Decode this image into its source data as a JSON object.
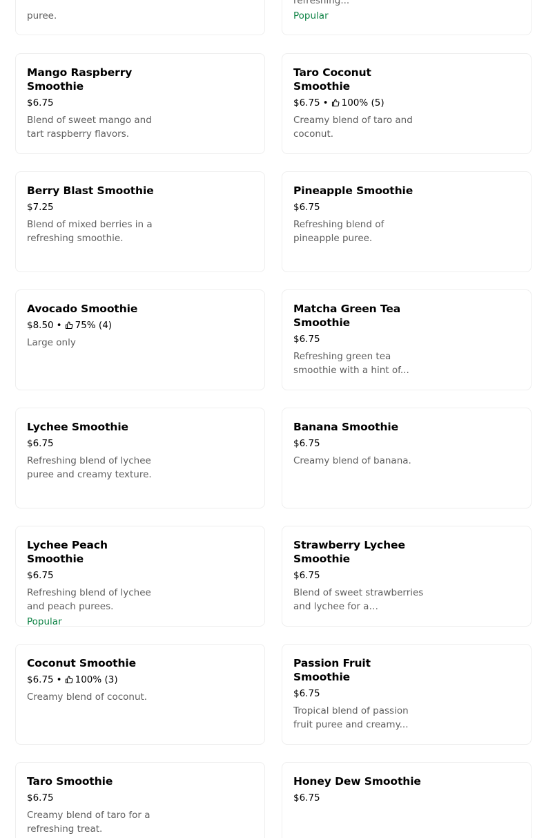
{
  "top_row": {
    "left": {
      "desc_tail": "puree."
    },
    "right": {
      "desc_tail": "to a smooth and refreshing...",
      "badge": "Popular"
    }
  },
  "items": [
    {
      "name": "Mango Raspberry Smoothie",
      "price": "$6.75",
      "rating": "",
      "desc": "Blend of sweet mango and tart raspberry flavors.",
      "badge": ""
    },
    {
      "name": "Taro Coconut Smoothie",
      "price": "$6.75",
      "rating": "100% (5)",
      "desc": "Creamy blend of taro and coconut.",
      "badge": ""
    },
    {
      "name": "Berry Blast Smoothie",
      "price": "$7.25",
      "rating": "",
      "desc": "Blend of mixed berries in a refreshing smoothie.",
      "badge": ""
    },
    {
      "name": "Pineapple Smoothie",
      "price": "$6.75",
      "rating": "",
      "desc": "Refreshing blend of pineapple puree.",
      "badge": ""
    },
    {
      "name": "Avocado Smoothie",
      "price": "$8.50",
      "rating": "75% (4)",
      "desc": "Large only",
      "badge": ""
    },
    {
      "name": "Matcha Green Tea Smoothie",
      "price": "$6.75",
      "rating": "",
      "desc": "Refreshing green tea smoothie with a hint of...",
      "badge": ""
    },
    {
      "name": "Lychee Smoothie",
      "price": "$6.75",
      "rating": "",
      "desc": "Refreshing blend of lychee puree and creamy texture.",
      "badge": ""
    },
    {
      "name": "Banana Smoothie",
      "price": "$6.75",
      "rating": "",
      "desc": "Creamy blend of banana.",
      "badge": ""
    },
    {
      "name": "Lychee Peach Smoothie",
      "price": "$6.75",
      "rating": "",
      "desc": "Refreshing blend of lychee and peach purees.",
      "badge": "Popular"
    },
    {
      "name": "Strawberry Lychee Smoothie",
      "price": "$6.75",
      "rating": "",
      "desc": "Blend of sweet strawberries and lychee for a refreshing...",
      "badge": ""
    },
    {
      "name": "Coconut Smoothie",
      "price": "$6.75",
      "rating": "100% (3)",
      "desc": "Creamy blend of coconut.",
      "badge": ""
    },
    {
      "name": "Passion Fruit Smoothie",
      "price": "$6.75",
      "rating": "",
      "desc": "Tropical blend of passion fruit puree and creamy...",
      "badge": ""
    },
    {
      "name": "Taro Smoothie",
      "price": "$6.75",
      "rating": "",
      "desc": "Creamy blend of taro for a refreshing treat.",
      "badge": ""
    },
    {
      "name": "Honey Dew Smoothie",
      "price": "$6.75",
      "rating": "",
      "desc": "",
      "badge": ""
    }
  ],
  "separator": "•",
  "icons": {
    "rating": "thumbs-up-icon"
  },
  "colors": {
    "badge": "#0e8345",
    "desc": "#5e5e5e",
    "border": "#eeeeee"
  }
}
